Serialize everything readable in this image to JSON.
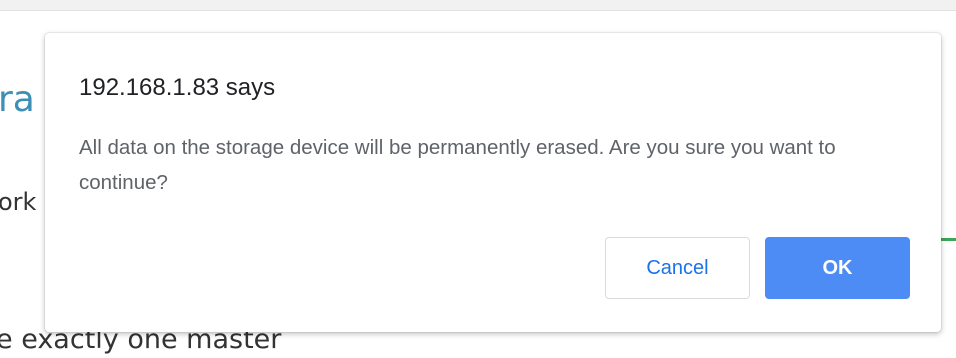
{
  "background_page": {
    "heading_fragment": "ra",
    "text_fragment": "ork",
    "bottom_text_fragment": "e exactly one master"
  },
  "dialog": {
    "title": "192.168.1.83 says",
    "message": "All data on the storage device will be permanently erased. Are you sure you want to continue?",
    "cancel_label": "Cancel",
    "ok_label": "OK"
  },
  "colors": {
    "accent": "#4d8cf5",
    "cancel_text": "#1a73e8",
    "link_heading": "#3d8fb5",
    "status_green": "#3aa757"
  }
}
